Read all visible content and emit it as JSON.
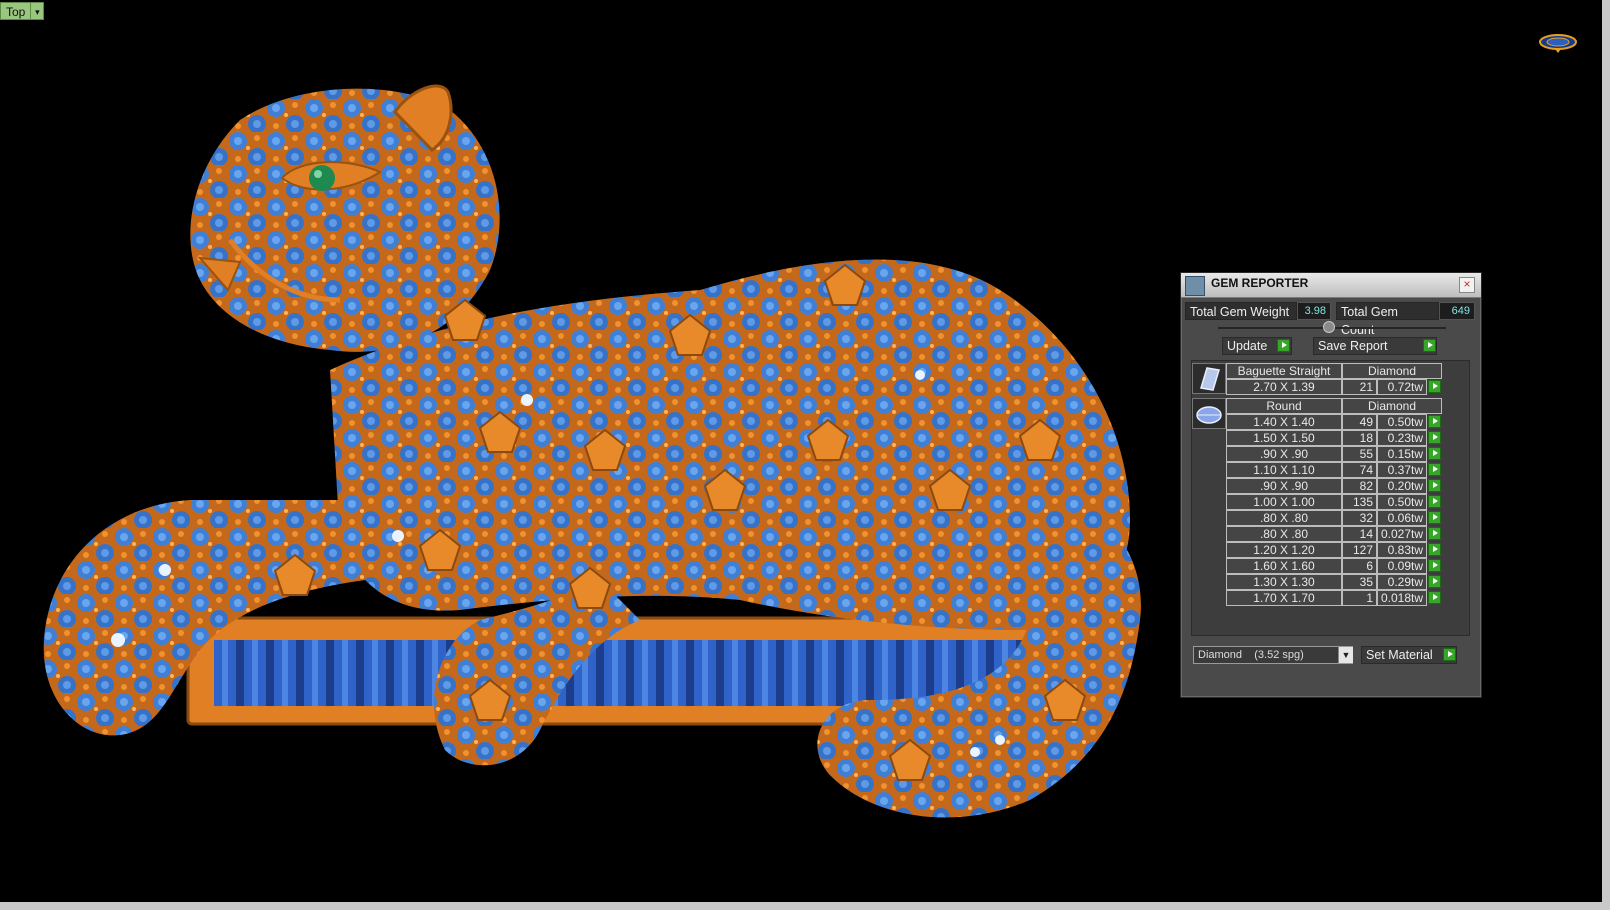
{
  "viewport": {
    "view_label": "Top",
    "view_arrow": "▾"
  },
  "colors": {
    "background": "#000000",
    "gold": "#e07f24",
    "gem_blue": "#3f7fd6",
    "emerald": "#1f8a50",
    "panel": "#4a4a4a",
    "accent_green": "#37a52a",
    "value_cyan": "#7fe6e0"
  },
  "gem_reporter": {
    "title": "GEM REPORTER",
    "close_glyph": "×",
    "total_weight_label": "Total Gem Weight",
    "total_weight_value": "3.98",
    "total_count_label": "Total Gem Count",
    "total_count_value": "649",
    "update_label": "Update",
    "save_report_label": "Save Report",
    "groups": [
      {
        "shape": "Baguette Straight",
        "material": "Diamond",
        "icon": "baguette-gem-icon",
        "rows": [
          {
            "size": "2.70 X 1.39",
            "count": "21",
            "weight": "0.72tw"
          }
        ]
      },
      {
        "shape": "Round",
        "material": "Diamond",
        "icon": "round-gem-icon",
        "rows": [
          {
            "size": "1.40 X 1.40",
            "count": "49",
            "weight": "0.50tw"
          },
          {
            "size": "1.50 X 1.50",
            "count": "18",
            "weight": "0.23tw"
          },
          {
            "size": ".90 X .90",
            "count": "55",
            "weight": "0.15tw"
          },
          {
            "size": "1.10 X 1.10",
            "count": "74",
            "weight": "0.37tw"
          },
          {
            "size": ".90 X .90",
            "count": "82",
            "weight": "0.20tw"
          },
          {
            "size": "1.00 X 1.00",
            "count": "135",
            "weight": "0.50tw"
          },
          {
            "size": ".80 X .80",
            "count": "32",
            "weight": "0.06tw"
          },
          {
            "size": ".80 X .80",
            "count": "14",
            "weight": "0.027tw"
          },
          {
            "size": "1.20 X 1.20",
            "count": "127",
            "weight": "0.83tw"
          },
          {
            "size": "1.60 X 1.60",
            "count": "6",
            "weight": "0.09tw"
          },
          {
            "size": "1.30 X 1.30",
            "count": "35",
            "weight": "0.29tw"
          },
          {
            "size": "1.70 X 1.70",
            "count": "1",
            "weight": "0.018tw"
          }
        ]
      }
    ],
    "material_value": "Diamond    (3.52 spg)",
    "material_arrow": "▼",
    "set_material_label": "Set Material"
  }
}
